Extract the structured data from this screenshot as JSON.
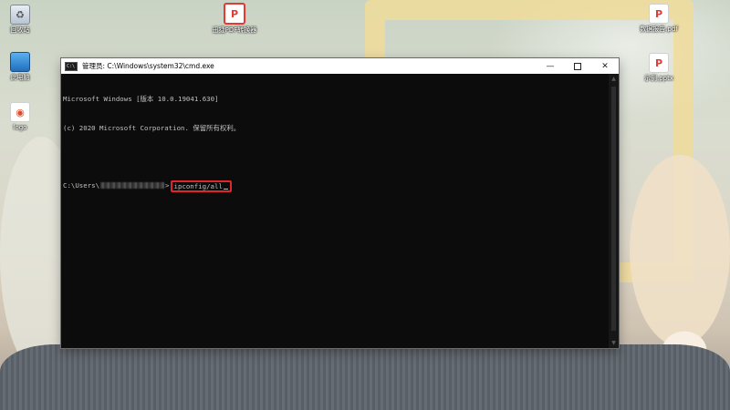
{
  "desktop": {
    "icons": [
      {
        "label": "回收站",
        "icon": "recycle-bin-icon"
      },
      {
        "label": "此电脑",
        "icon": "computer-icon"
      },
      {
        "label": "logo",
        "icon": "logo-image-icon"
      },
      {
        "label": "迅捷PDF转换器",
        "icon": "pdf-converter-app-icon"
      },
      {
        "label": "数据报告.pdf",
        "icon": "pdf-file-icon"
      },
      {
        "label": "示例.pptx",
        "icon": "pptx-file-icon"
      }
    ]
  },
  "window": {
    "title": "管理员: C:\\Windows\\system32\\cmd.exe",
    "title_icon_text": "C:\\",
    "controls": {
      "minimize": "—",
      "maximize": "",
      "close": "✕"
    }
  },
  "console": {
    "lines": [
      "Microsoft Windows [版本 10.0.19041.630]",
      "(c) 2020 Microsoft Corporation. 保留所有权利。"
    ],
    "prompt_prefix": "C:\\Users\\",
    "prompt_suffix": ">",
    "command": "ipconfig/all"
  },
  "colors": {
    "console_bg": "#0c0c0c",
    "console_text": "#c0c0c0",
    "highlight_box": "#e0262a"
  }
}
